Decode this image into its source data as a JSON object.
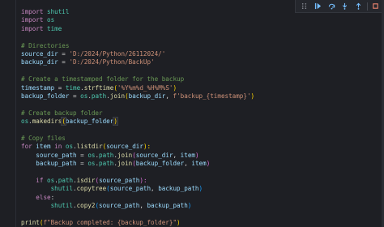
{
  "code": {
    "lines": [
      [
        "import",
        " ",
        "shutil"
      ],
      [
        "import",
        " ",
        "os"
      ],
      [
        "import",
        " ",
        "time"
      ],
      [],
      [
        "# Directories"
      ],
      [
        "source_dir",
        " = ",
        "'D:/2024/Python/26112024/'"
      ],
      [
        "backup_dir",
        " = ",
        "'D:/2024/Python/BackUp'"
      ],
      [],
      [
        "# Create a timestamped folder for the backup"
      ],
      [
        "timestamp",
        " = ",
        "time",
        ".",
        "strftime",
        "(",
        "'%Y%m%d_%H%M%S'",
        ")"
      ],
      [
        "backup_folder",
        " = ",
        "os",
        ".",
        "path",
        ".",
        "join",
        "(",
        "backup_dir",
        ", ",
        "f'backup_{timestamp}'",
        ")"
      ],
      [],
      [
        "# Create backup folder"
      ],
      [
        "os",
        ".",
        "makedirs",
        "(",
        "backup_folder",
        ")"
      ],
      [],
      [
        "# Copy files"
      ],
      [
        "for",
        " ",
        "item",
        " ",
        "in",
        " ",
        "os",
        ".",
        "listdir",
        "(",
        "source_dir",
        "):"
      ],
      [
        "    ",
        "source_path",
        " = ",
        "os",
        ".",
        "path",
        ".",
        "join",
        "(",
        "source_dir",
        ", ",
        "item",
        ")"
      ],
      [
        "    ",
        "backup_path",
        " = ",
        "os",
        ".",
        "path",
        ".",
        "join",
        "(",
        "backup_folder",
        ", ",
        "item",
        ")"
      ],
      [],
      [
        "    ",
        "if",
        " ",
        "os",
        ".",
        "path",
        ".",
        "isdir",
        "(",
        "source_path",
        "):"
      ],
      [
        "        ",
        "shutil",
        ".",
        "copytree",
        "(",
        "source_path",
        ", ",
        "backup_path",
        ")"
      ],
      [
        "    ",
        "else",
        ":"
      ],
      [
        "        ",
        "shutil",
        ".",
        "copy2",
        "(",
        "source_path",
        ", ",
        "backup_path",
        ")"
      ],
      [],
      [
        "print",
        "(",
        "f\"Backup completed: {backup_folder}\"",
        ")"
      ]
    ],
    "classes": [
      [
        "kw",
        "op",
        "mod"
      ],
      [
        "kw",
        "op",
        "mod"
      ],
      [
        "kw",
        "op",
        "mod"
      ],
      [],
      [
        "cm"
      ],
      [
        "var",
        "op",
        "str"
      ],
      [
        "var",
        "op",
        "str"
      ],
      [],
      [
        "cm"
      ],
      [
        "var",
        "op",
        "mod",
        "op",
        "fn",
        "br1",
        "str",
        "br1"
      ],
      [
        "var",
        "op",
        "mod",
        "op",
        "mod",
        "op",
        "fn",
        "br1",
        "var",
        "op",
        "str",
        "br1"
      ],
      [],
      [
        "cm"
      ],
      [
        "mod",
        "op",
        "fn",
        "br1 hl",
        "var",
        "br1 hl"
      ],
      [],
      [
        "cm"
      ],
      [
        "kw",
        "op",
        "var",
        "op",
        "kw",
        "op",
        "mod",
        "op",
        "fn",
        "br1",
        "var",
        "br1"
      ],
      [
        "op",
        "var",
        "op",
        "mod",
        "op",
        "mod",
        "op",
        "fn",
        "br2",
        "var",
        "op",
        "var",
        "br2"
      ],
      [
        "op",
        "var",
        "op",
        "mod",
        "op",
        "mod",
        "op",
        "fn",
        "br2",
        "var",
        "op",
        "var",
        "br2"
      ],
      [],
      [
        "op",
        "kw",
        "op",
        "mod",
        "op",
        "mod",
        "op",
        "fn",
        "br2",
        "var",
        "br2"
      ],
      [
        "op",
        "mod",
        "op",
        "fn",
        "br3",
        "var",
        "op",
        "var",
        "br3"
      ],
      [
        "op",
        "kw",
        "op"
      ],
      [
        "op",
        "mod",
        "op",
        "fn",
        "br3",
        "var",
        "op",
        "var",
        "br3"
      ],
      [],
      [
        "fn",
        "br1",
        "str",
        "br1"
      ]
    ]
  },
  "toolbar": {
    "icons": [
      "run-step-icon",
      "restart-icon",
      "step-over-icon",
      "step-into-icon",
      "step-out-icon",
      "stop-icon"
    ]
  }
}
